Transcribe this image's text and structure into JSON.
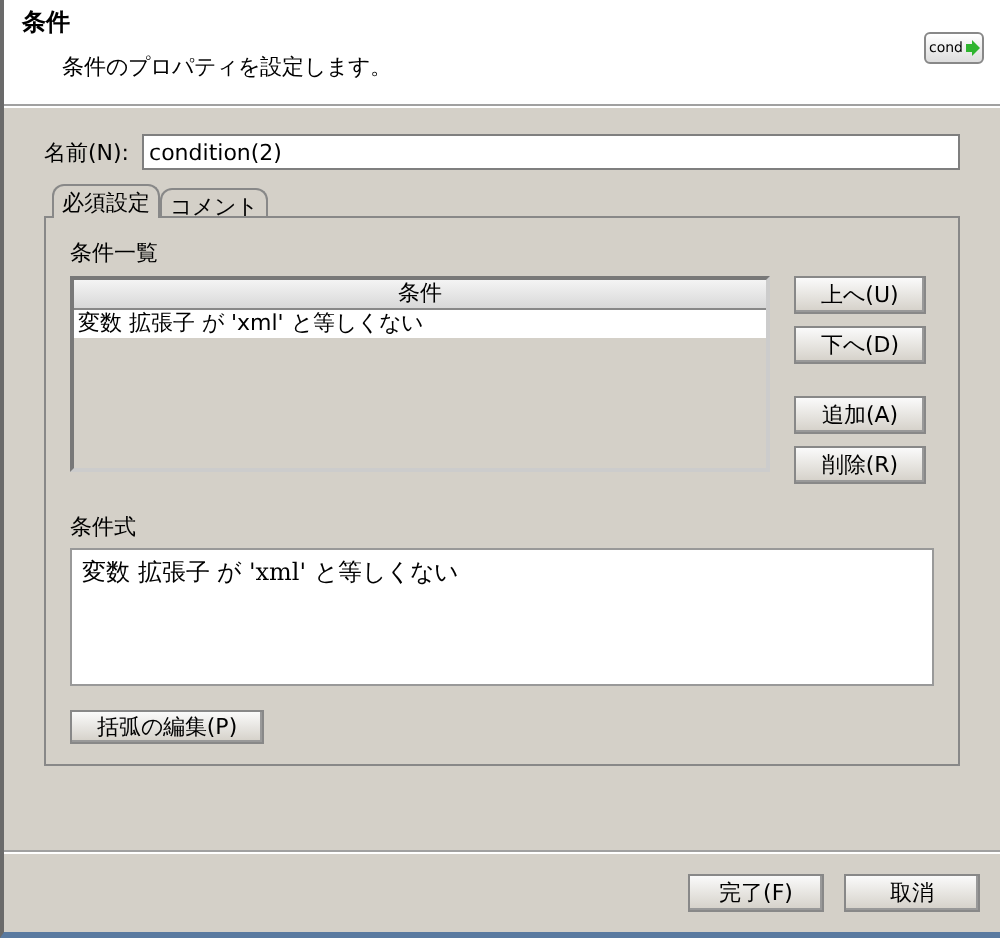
{
  "header": {
    "title": "条件",
    "subtitle": "条件のプロパティを設定します。",
    "badge": "cond"
  },
  "name_field": {
    "label": "名前(N):",
    "value": "condition(2)"
  },
  "tabs": [
    {
      "label": "必須設定",
      "selected": true
    },
    {
      "label": "コメント",
      "selected": false
    }
  ],
  "condition_list": {
    "label": "条件一覧",
    "column": "条件",
    "rows": [
      {
        "text": "変数 拡張子 が 'xml' と等しくない",
        "selected": true
      }
    ]
  },
  "list_buttons": [
    "上へ(U)",
    "下へ(D)",
    "追加(A)",
    "削除(R)"
  ],
  "expression": {
    "label": "条件式",
    "value": "変数 拡張子 が 'xml' と等しくない"
  },
  "paren_button": "括弧の編集(P)",
  "footer_buttons": [
    "完了(F)",
    "取消"
  ]
}
